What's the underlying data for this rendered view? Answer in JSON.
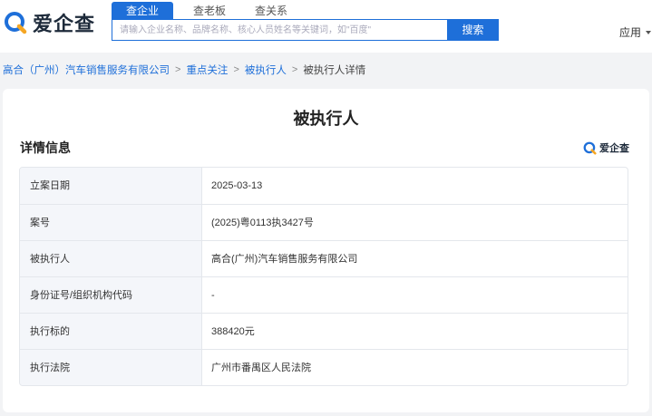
{
  "header": {
    "logo_text": "爱企查",
    "tabs": [
      {
        "label": "查企业",
        "active": true
      },
      {
        "label": "查老板",
        "active": false
      },
      {
        "label": "查关系",
        "active": false
      }
    ],
    "search_placeholder": "请输入企业名称、品牌名称、核心人员姓名等关键词，如\"百度\"",
    "search_button": "搜索",
    "app_menu": "应用"
  },
  "breadcrumb": {
    "items": [
      "高合（广州）汽车销售服务有限公司",
      "重点关注",
      "被执行人"
    ],
    "separator": ">",
    "current": "被执行人详情"
  },
  "card": {
    "title": "被执行人",
    "section_title": "详情信息",
    "watermark_text": "爱企查",
    "rows": [
      {
        "label": "立案日期",
        "value": "2025-03-13"
      },
      {
        "label": "案号",
        "value": "(2025)粤0113执3427号"
      },
      {
        "label": "被执行人",
        "value": "高合(广州)汽车销售服务有限公司"
      },
      {
        "label": "身份证号/组织机构代码",
        "value": "-"
      },
      {
        "label": "执行标的",
        "value": "388420元"
      },
      {
        "label": "执行法院",
        "value": "广州市番禺区人民法院"
      }
    ]
  },
  "colors": {
    "accent": "#1e6fd9",
    "logo_ring": "#1e6fd9",
    "logo_tail": "#f5a623",
    "page_bg": "#f2f3f5"
  }
}
